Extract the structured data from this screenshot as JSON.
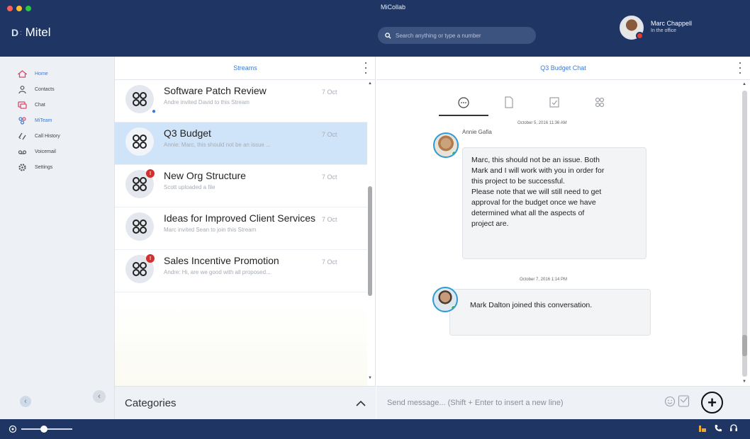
{
  "app": {
    "brand": "Mitel",
    "brand_mark": "D",
    "window_title": "MiCollab"
  },
  "search": {
    "placeholder": "Search anything or type a number"
  },
  "user": {
    "name": "Marc Chappell",
    "status": "In the office"
  },
  "nav": {
    "items": [
      {
        "label": "Home",
        "icon": "home-icon",
        "active": true
      },
      {
        "label": "Contacts",
        "icon": "contacts-icon",
        "active": false
      },
      {
        "label": "Chat",
        "icon": "chat-icon",
        "active": false
      },
      {
        "label": "MiTeam",
        "icon": "team-icon",
        "active": false
      },
      {
        "label": "Call History",
        "icon": "call-history-icon",
        "active": false
      },
      {
        "label": "Voicemail",
        "icon": "voicemail-icon",
        "active": false
      },
      {
        "label": "Settings",
        "icon": "gear-icon",
        "active": false
      }
    ]
  },
  "streams": {
    "title": "Streams",
    "items": [
      {
        "title": "Software Patch Review",
        "subtitle": "Andre invited David to this Stream",
        "date": "7 Oct",
        "badge": "",
        "person": true,
        "selected": false
      },
      {
        "title": "Q3 Budget",
        "subtitle": "Annie: Marc, this should not be an issue ...",
        "date": "7 Oct",
        "badge": "",
        "person": false,
        "selected": true
      },
      {
        "title": "New Org Structure",
        "subtitle": "Scott uploaded a file",
        "date": "7 Oct",
        "badge": "!",
        "person": false,
        "selected": false
      },
      {
        "title": "Ideas for Improved Client Services",
        "subtitle": "Marc invited Sean to join this Stream",
        "date": "7 Oct",
        "badge": "",
        "person": false,
        "selected": false
      },
      {
        "title": "Sales Incentive Promotion",
        "subtitle": "Andre: Hi, are we good with all proposed...",
        "date": "7 Oct",
        "badge": "!",
        "person": false,
        "selected": false
      }
    ],
    "categories_label": "Categories"
  },
  "chat": {
    "title": "Q3 Budget Chat",
    "tabs": [
      {
        "icon": "chat-bubble-icon",
        "active": true
      },
      {
        "icon": "file-icon",
        "active": false
      },
      {
        "icon": "task-icon",
        "active": false
      },
      {
        "icon": "team-icon",
        "active": false
      }
    ],
    "messages": [
      {
        "time": "October 5, 2016 11:36 AM",
        "sender": "Annie Gafia",
        "lines": [
          "Marc, this should not be an issue. Both",
          "Mark and I will work with you in order for",
          "this project to be successful.",
          "Please note that we will still need to get",
          "approval for the budget once we have",
          "determined what all the aspects of",
          "project are."
        ]
      },
      {
        "time": "October 7, 2016 1:14 PM",
        "sender": "",
        "lines": [
          "Mark Dalton joined this conversation."
        ]
      }
    ],
    "composer_placeholder": "Send message... (Shift + Enter to insert a new line)"
  },
  "volume": {
    "level": 0.45
  },
  "colors": {
    "brand": "#1f3563",
    "accent": "#3d7ad6",
    "selected_row": "#cfe4f8",
    "badge": "#d32f2f"
  }
}
